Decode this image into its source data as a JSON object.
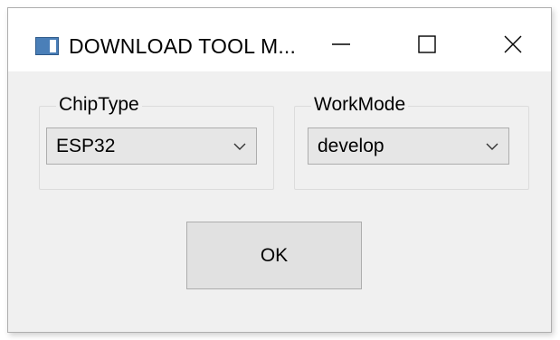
{
  "window": {
    "title": "DOWNLOAD TOOL M...",
    "icon": "app-window-icon"
  },
  "title_controls": {
    "minimize_icon": "minimize-icon",
    "maximize_icon": "maximize-icon",
    "close_icon": "close-icon"
  },
  "chip_type": {
    "label": "ChipType",
    "selected": "ESP32",
    "icon": "chevron-down-icon"
  },
  "work_mode": {
    "label": "WorkMode",
    "selected": "develop",
    "icon": "chevron-down-icon"
  },
  "ok_button": {
    "label": "OK"
  },
  "colors": {
    "window_bg": "#f0f0f0",
    "titlebar_bg": "#ffffff",
    "button_bg": "#e1e1e1",
    "select_bg": "#e6e6e6",
    "border": "#adadad"
  }
}
